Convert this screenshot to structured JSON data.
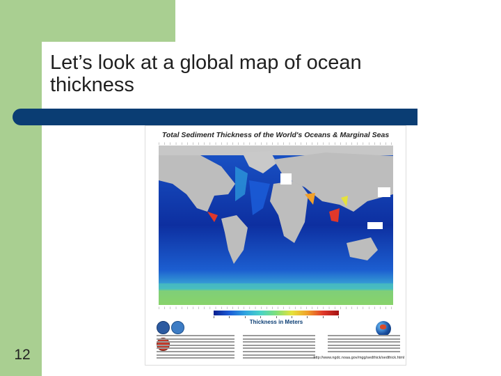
{
  "slide": {
    "title": "Let’s look at a global map of ocean thickness",
    "number": "12"
  },
  "figure": {
    "title": "Total Sediment Thickness of the World's Oceans & Marginal Seas",
    "colorbar_label": "Thickness in Meters",
    "url": "http://www.ngdc.noaa.gov/mgg/sedthick/sedthick.html"
  },
  "colors": {
    "green_band": "#a9cf91",
    "title_bar": "#0a3d73",
    "ocean_deep": "#0a1f8f",
    "land": "#bdbdbd"
  }
}
